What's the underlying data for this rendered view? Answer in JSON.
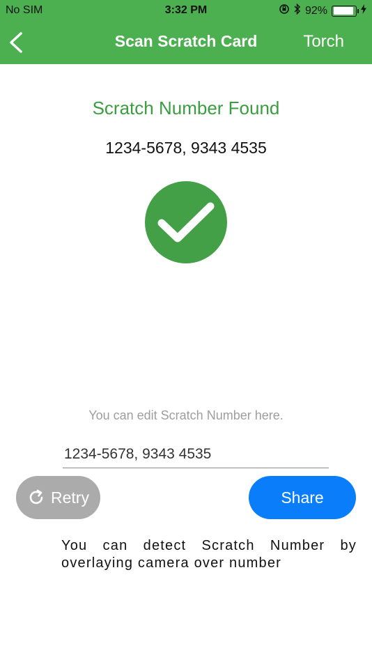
{
  "status": {
    "carrier": "No SIM",
    "time": "3:32 PM",
    "battery": "92%",
    "battery_level": 0.92
  },
  "nav": {
    "title": "Scan Scratch Card",
    "torch_label": "Torch",
    "back_icon": "chevron-left-icon"
  },
  "result": {
    "title": "Scratch Number Found",
    "number": "1234-5678, 9343 4535"
  },
  "edit": {
    "hint": "You can edit Scratch Number here.",
    "value": "1234-5678, 9343 4535"
  },
  "actions": {
    "retry_label": "Retry",
    "share_label": "Share"
  },
  "info": {
    "line1": "You can detect Scratch Number by",
    "line2": "overlaying camera over number"
  },
  "colors": {
    "primary_green": "#4caf50",
    "check_green": "#43a047",
    "share_blue": "#0a7dfb",
    "retry_gray": "#ababab"
  }
}
